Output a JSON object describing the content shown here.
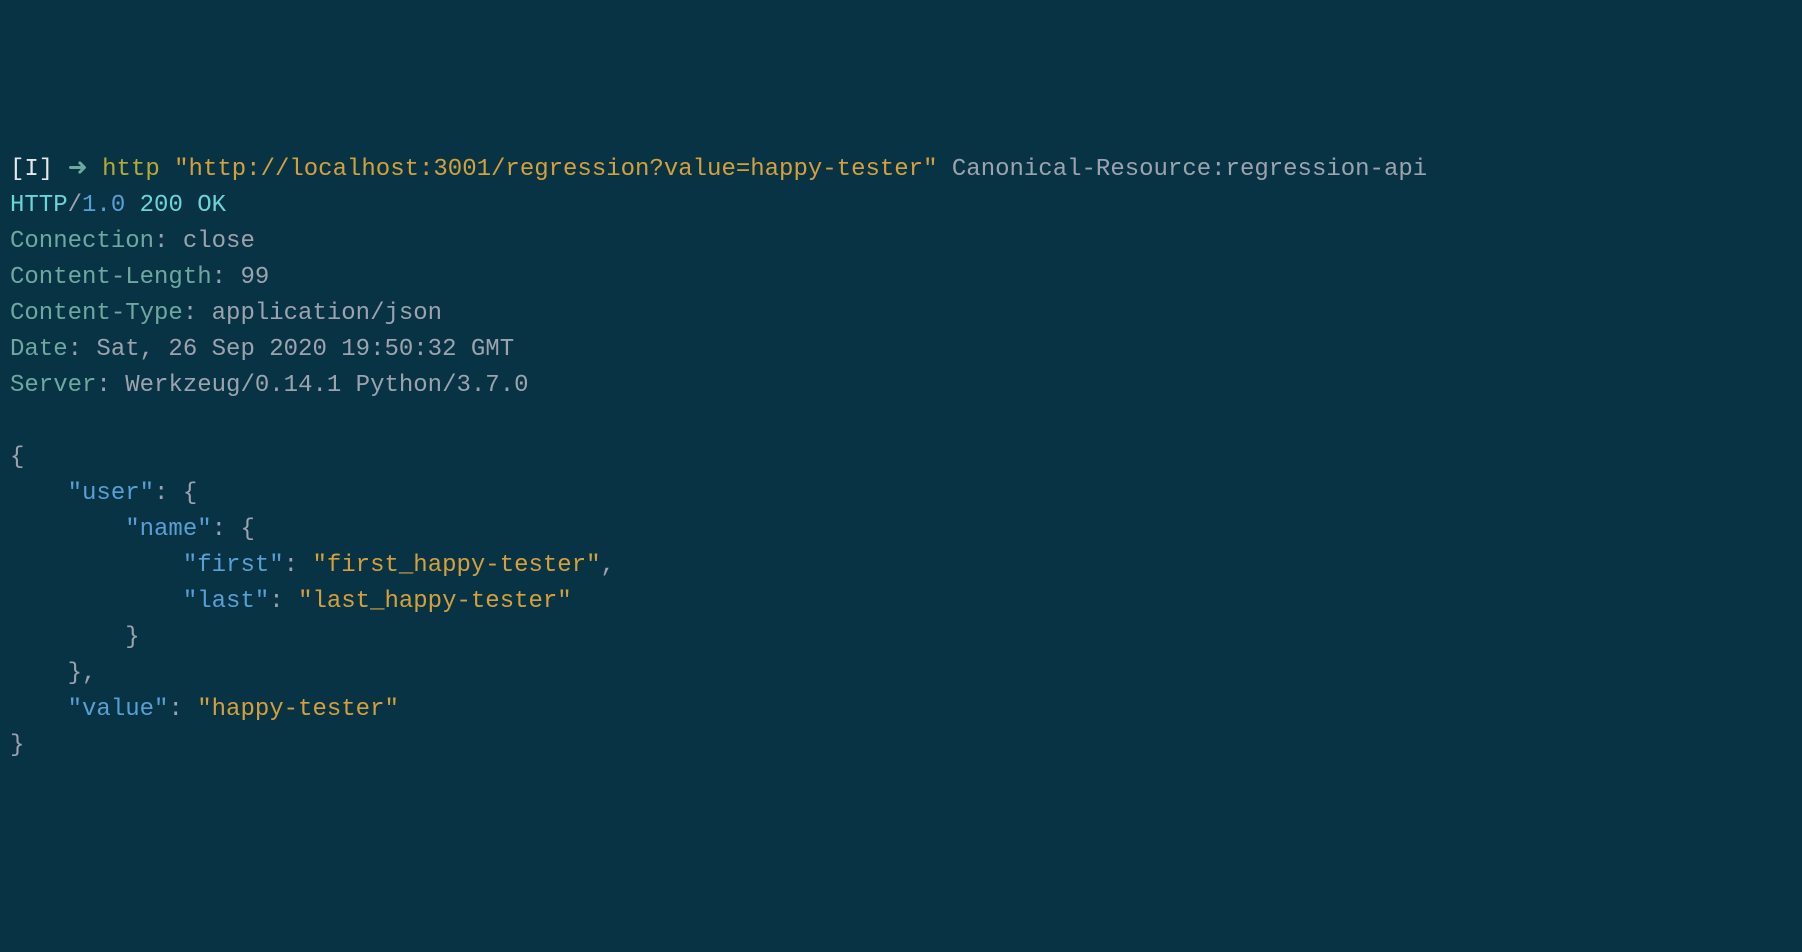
{
  "prompt": {
    "bracket": "[I]",
    "arrow": "➜",
    "command": "http",
    "url": "\"http://localhost:3001/regression?value=happy-tester\"",
    "extra": "Canonical-Resource:regression-api"
  },
  "status_line": {
    "proto": "HTTP",
    "slash": "/",
    "version": "1.0",
    "status": "200 OK"
  },
  "headers": {
    "connection": {
      "k": "Connection",
      "v": "close"
    },
    "content_length": {
      "k": "Content-Length",
      "v": "99"
    },
    "content_type": {
      "k": "Content-Type",
      "v": "application/json"
    },
    "date": {
      "k": "Date",
      "v": "Sat, 26 Sep 2020 19:50:32 GMT"
    },
    "server": {
      "k": "Server",
      "v": "Werkzeug/0.14.1 Python/3.7.0"
    }
  },
  "json_body": {
    "open": "{",
    "user_key": "\"user\"",
    "user_open": ": {",
    "name_key": "\"name\"",
    "name_open": ": {",
    "first_key": "\"first\"",
    "first_val": "\"first_happy-tester\"",
    "last_key": "\"last\"",
    "last_val": "\"last_happy-tester\"",
    "name_close": "}",
    "user_close": "},",
    "value_key": "\"value\"",
    "value_val": "\"happy-tester\"",
    "close": "}",
    "colon": ": ",
    "comma": ","
  }
}
